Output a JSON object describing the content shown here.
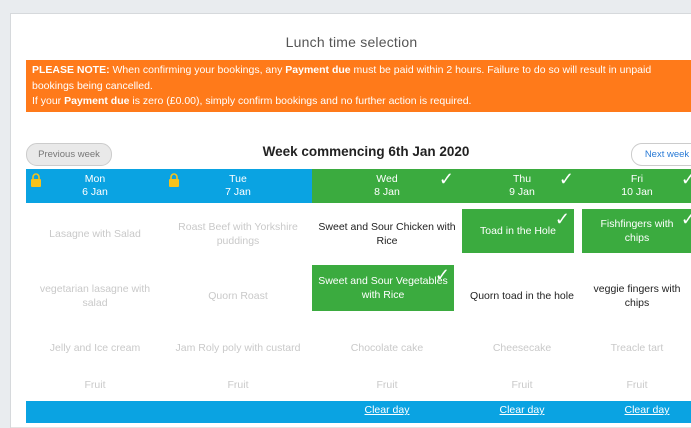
{
  "page_title": "Lunch time selection",
  "notice": {
    "label": "PLEASE NOTE:",
    "text1": " When confirming your bookings, any ",
    "payment_due": "Payment due",
    "text2": " must be paid within 2 hours. Failure to do so will result in unpaid bookings being cancelled.",
    "text3": "If your ",
    "payment_due_2": "Payment due",
    "text4": " is zero (£0.00), simply confirm bookings and no further action is required."
  },
  "week": {
    "prev_label": "Previous week",
    "title": "Week commencing 6th Jan 2020",
    "next_label": "Next week"
  },
  "days": [
    {
      "day": "Mon",
      "date": "6 Jan",
      "locked": true
    },
    {
      "day": "Tue",
      "date": "7 Jan",
      "locked": true
    },
    {
      "day": "Wed",
      "date": "8 Jan",
      "checked": true
    },
    {
      "day": "Thu",
      "date": "9 Jan",
      "checked": true
    },
    {
      "day": "Fri",
      "date": "10 Jan",
      "checked": true
    }
  ],
  "rows": [
    [
      "Lasagne with Salad",
      "Roast Beef with Yorkshire puddings",
      "Sweet and Sour Chicken with Rice",
      "Toad in the Hole",
      "Fishfingers with chips"
    ],
    [
      "vegetarian lasagne with salad",
      "Quorn Roast",
      "Sweet and Sour Vegetables with Rice",
      "Quorn toad in the hole",
      "veggie fingers with chips"
    ],
    [
      "Jelly and Ice cream",
      "Jam Roly poly with custard",
      "Chocolate cake",
      "Cheesecake",
      "Treacle tart"
    ],
    [
      "Fruit",
      "Fruit",
      "Fruit",
      "Fruit",
      "Fruit"
    ]
  ],
  "clear_day_label": "Clear day",
  "colors": {
    "notice": "#ff7a1a",
    "header_blue": "#0aa3e2",
    "selected_green": "#3bab3f"
  },
  "icons": {
    "lock": "lock-icon",
    "check": "checkmark-icon"
  }
}
